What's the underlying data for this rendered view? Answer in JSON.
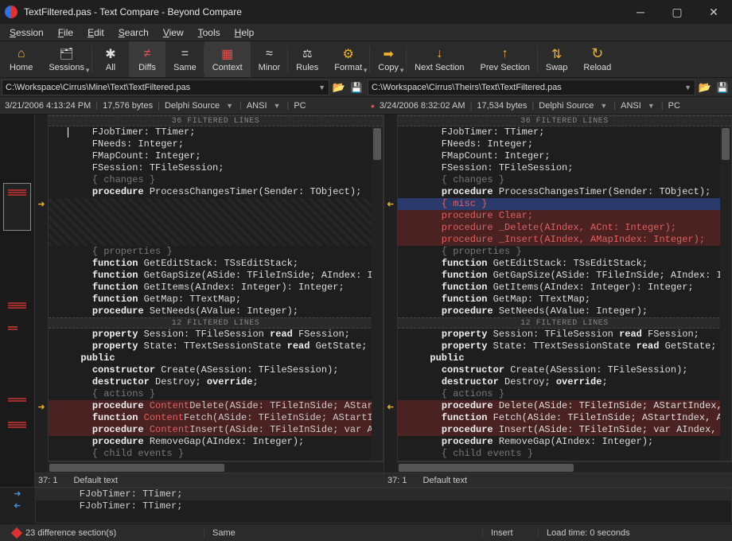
{
  "window": {
    "title": "TextFiltered.pas - Text Compare - Beyond Compare"
  },
  "menubar": [
    "Session",
    "File",
    "Edit",
    "Search",
    "View",
    "Tools",
    "Help"
  ],
  "toolbar": [
    {
      "id": "home",
      "label": "Home",
      "icon": "home"
    },
    {
      "id": "sessions",
      "label": "Sessions",
      "icon": "sessions",
      "sep": true,
      "dd": true
    },
    {
      "id": "all",
      "label": "All",
      "icon": "all"
    },
    {
      "id": "diffs",
      "label": "Diffs",
      "icon": "diffs",
      "active": true
    },
    {
      "id": "same",
      "label": "Same",
      "icon": "same",
      "sep": true
    },
    {
      "id": "context",
      "label": "Context",
      "icon": "context",
      "active": true
    },
    {
      "id": "minor",
      "label": "Minor",
      "icon": "minor",
      "sep": true
    },
    {
      "id": "rules",
      "label": "Rules",
      "icon": "rules"
    },
    {
      "id": "format",
      "label": "Format",
      "icon": "format",
      "sep": true,
      "dd": true
    },
    {
      "id": "copy",
      "label": "Copy",
      "icon": "copy",
      "sep": true,
      "dd": true
    },
    {
      "id": "next",
      "label": "Next Section",
      "icon": "next"
    },
    {
      "id": "prev",
      "label": "Prev Section",
      "icon": "prev",
      "sep": true
    },
    {
      "id": "swap",
      "label": "Swap",
      "icon": "swap"
    },
    {
      "id": "reload",
      "label": "Reload",
      "icon": "reload"
    }
  ],
  "left": {
    "path": "C:\\Workspace\\Cirrus\\Mine\\Text\\TextFiltered.pas",
    "timestamp": "3/21/2006 4:13:24 PM",
    "bytes": "17,576 bytes",
    "lang": "Delphi Source",
    "enc": "ANSI",
    "newline": "PC",
    "caret": "37: 1",
    "mode": "Default text"
  },
  "right": {
    "path": "C:\\Workspace\\Cirrus\\Theirs\\Text\\TextFiltered.pas",
    "timestamp": "3/24/2006 8:32:02 AM",
    "bytes": "17,534 bytes",
    "lang": "Delphi Source",
    "enc": "ANSI",
    "newline": "PC",
    "caret": "37: 1",
    "mode": "Default text",
    "dirty": true
  },
  "filtered1": "36 FILTERED LINES",
  "filtered2": "12 FILTERED LINES",
  "leftBlock1": [
    {
      "t": "    FJobTimer: TTimer;",
      "cursor": true
    },
    {
      "t": "    FNeeds: Integer;"
    },
    {
      "t": "    FMapCount: Integer;"
    },
    {
      "t": "    FSession: TFileSession;"
    },
    {
      "t": "    { changes }",
      "cm": true
    },
    {
      "t": "    procedure ProcessChangesTimer(Sender: TObject);",
      "kw": "procedure"
    },
    {
      "hatch": true
    },
    {
      "hatch": true
    },
    {
      "hatch": true
    },
    {
      "hatch": true
    },
    {
      "t": "    { properties }",
      "cm": true
    },
    {
      "t": "    function GetEditStack: TSsEditStack;",
      "kw": "function"
    },
    {
      "t": "    function GetGapSize(ASide: TFileInSide; AIndex: Int",
      "kw": "function"
    },
    {
      "t": "    function GetItems(AIndex: Integer): Integer;",
      "kw": "function"
    },
    {
      "t": "    function GetMap: TTextMap;",
      "kw": "function"
    },
    {
      "t": "    procedure SetNeeds(AValue: Integer);",
      "kw": "procedure"
    }
  ],
  "rightBlock1": [
    {
      "t": "    FJobTimer: TTimer;"
    },
    {
      "t": "    FNeeds: Integer;"
    },
    {
      "t": "    FMapCount: Integer;"
    },
    {
      "t": "    FSession: TFileSession;"
    },
    {
      "t": "    { changes }",
      "cm": true
    },
    {
      "t": "    procedure ProcessChangesTimer(Sender: TObject);",
      "kw": "procedure"
    },
    {
      "t": "    { misc }",
      "diffsel": true,
      "hl": true
    },
    {
      "t": "    procedure Clear;",
      "diff": true,
      "hl": true
    },
    {
      "t": "    procedure _Delete(AIndex, ACnt: Integer);",
      "diff": true,
      "hl": true
    },
    {
      "t": "    procedure _Insert(AIndex, AMapIndex: Integer);",
      "diff": true,
      "hl": true
    },
    {
      "t": "    { properties }",
      "cm": true
    },
    {
      "t": "    function GetEditStack: TSsEditStack;",
      "kw": "function"
    },
    {
      "t": "    function GetGapSize(ASide: TFileInSide; AIndex: Int",
      "kw": "function"
    },
    {
      "t": "    function GetItems(AIndex: Integer): Integer;",
      "kw": "function"
    },
    {
      "t": "    function GetMap: TTextMap;",
      "kw": "function"
    },
    {
      "t": "    procedure SetNeeds(AValue: Integer);",
      "kw": "procedure"
    }
  ],
  "leftBlock2": [
    {
      "t": "    property Session: TFileSession read FSession;",
      "kw": "property",
      "kw2": "read"
    },
    {
      "t": "    property State: TTextSessionState read GetState;",
      "kw": "property",
      "kw2": "read"
    },
    {
      "t": "  public",
      "kw": "public"
    },
    {
      "t": "    constructor Create(ASession: TFileSession);",
      "kw": "constructor"
    },
    {
      "t": "    destructor Destroy; override;",
      "kw": "destructor",
      "kw2": "override"
    },
    {
      "t": "    { actions }",
      "cm": true
    },
    {
      "pre": "    procedure ",
      "hlpart": "Content",
      "post": "Delete(ASide: TFileInSide; AStartIn",
      "diff": true,
      "kw": "procedure"
    },
    {
      "pre": "    function ",
      "hlpart": "Content",
      "post": "Fetch(ASide: TFileInSide; AStartIn",
      "diff": true,
      "kw": "function"
    },
    {
      "pre": "    procedure ",
      "hlpart": "Content",
      "post": "Insert(ASide: TFileInSide; var AI",
      "diff": true,
      "kw": "procedure"
    },
    {
      "t": "    procedure RemoveGap(AIndex: Integer);",
      "kw": "procedure"
    },
    {
      "t": "    { child events }",
      "cm": true
    }
  ],
  "rightBlock2": [
    {
      "t": "    property Session: TFileSession read FSession;",
      "kw": "property",
      "kw2": "read"
    },
    {
      "t": "    property State: TTextSessionState read GetState;",
      "kw": "property",
      "kw2": "read"
    },
    {
      "t": "  public",
      "kw": "public"
    },
    {
      "t": "    constructor Create(ASession: TFileSession);",
      "kw": "constructor"
    },
    {
      "t": "    destructor Destroy; override;",
      "kw": "destructor",
      "kw2": "override"
    },
    {
      "t": "    { actions }",
      "cm": true
    },
    {
      "t": "    procedure Delete(ASide: TFileInSide; AStartIndex,",
      "diff": true,
      "kw": "procedure"
    },
    {
      "t": "    function Fetch(ASide: TFileInSide; AStartIndex, AS",
      "diff": true,
      "kw": "function"
    },
    {
      "t": "    procedure Insert(ASide: TFileInSide; var AIndex, A",
      "diff": true,
      "kw": "procedure"
    },
    {
      "t": "    procedure RemoveGap(AIndex: Integer);",
      "kw": "procedure"
    },
    {
      "t": "    { child events }",
      "cm": true
    }
  ],
  "merge": [
    "    FJobTimer: TTimer;",
    "    FJobTimer: TTimer;"
  ],
  "status": {
    "diff": "23 difference section(s)",
    "same": "Same",
    "insert": "Insert",
    "load": "Load time: 0 seconds"
  }
}
